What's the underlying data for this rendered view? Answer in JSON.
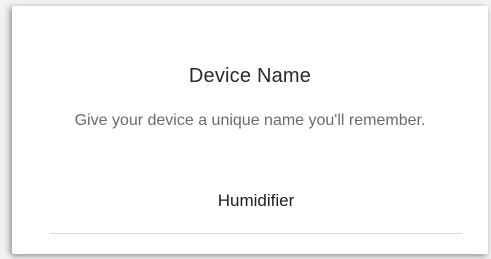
{
  "dialog": {
    "title": "Device Name",
    "subtitle": "Give your device a unique name you'll remember.",
    "name_field": {
      "value": "Humidifier"
    }
  }
}
